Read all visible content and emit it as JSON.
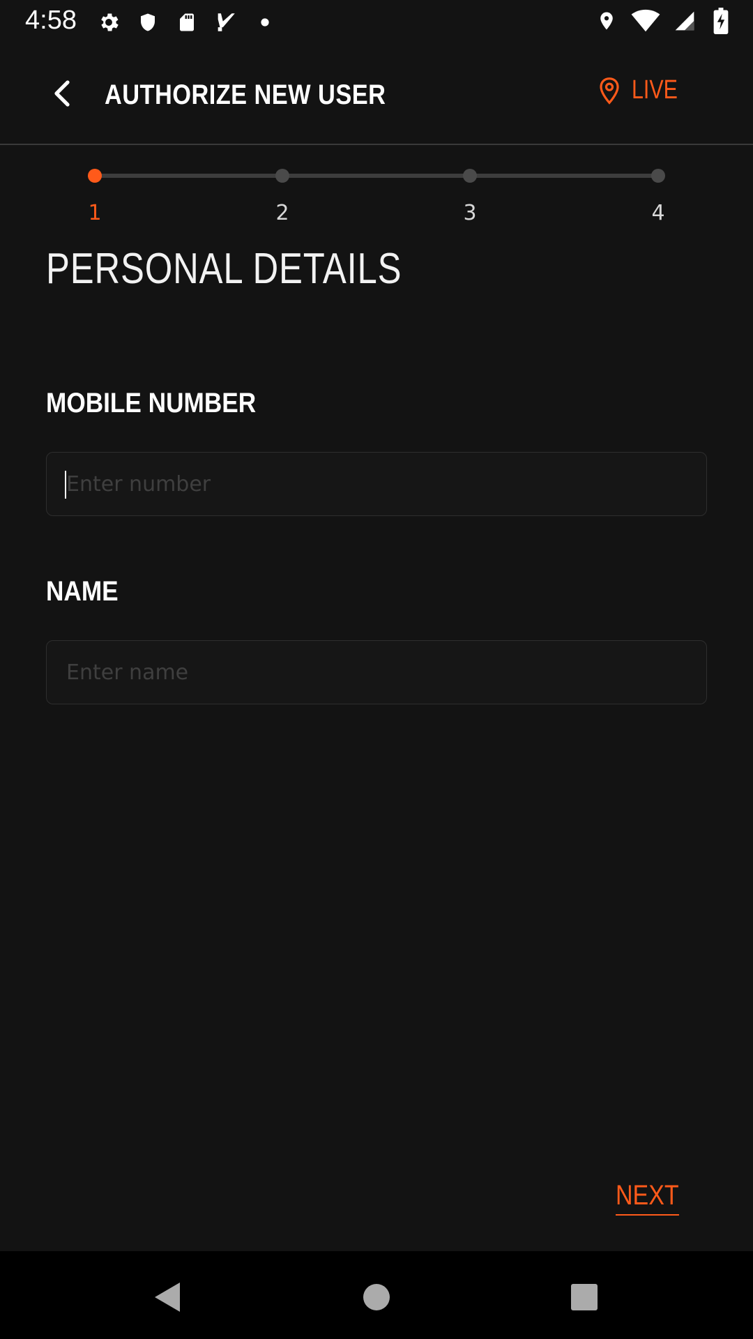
{
  "status_bar": {
    "time": "4:58",
    "left_icons": [
      "gear-icon",
      "shield-icon",
      "sd-card-icon",
      "check-flag-icon",
      "dot-icon"
    ],
    "right_icons": [
      "location-icon",
      "wifi-icon",
      "signal-icon",
      "battery-charging-icon"
    ]
  },
  "app_bar": {
    "back_icon": "chevron-left-icon",
    "title": "AUTHORIZE NEW USER",
    "live_icon": "map-pin-icon",
    "live_label": "LIVE"
  },
  "stepper": {
    "steps": [
      "1",
      "2",
      "3",
      "4"
    ],
    "active_step": 1
  },
  "section_title": "PERSONAL DETAILS",
  "form": {
    "mobile": {
      "label": "MOBILE NUMBER",
      "placeholder": "Enter number",
      "value": ""
    },
    "name": {
      "label": "NAME",
      "placeholder": "Enter name",
      "value": ""
    }
  },
  "next_label": "NEXT",
  "nav_bar": {
    "back": "triangle-back-icon",
    "home": "circle-home-icon",
    "recents": "square-recents-icon"
  },
  "colors": {
    "background": "#131313",
    "accent": "#ff5a1a",
    "text": "#ffffff",
    "inactive": "#4a4a4a"
  }
}
